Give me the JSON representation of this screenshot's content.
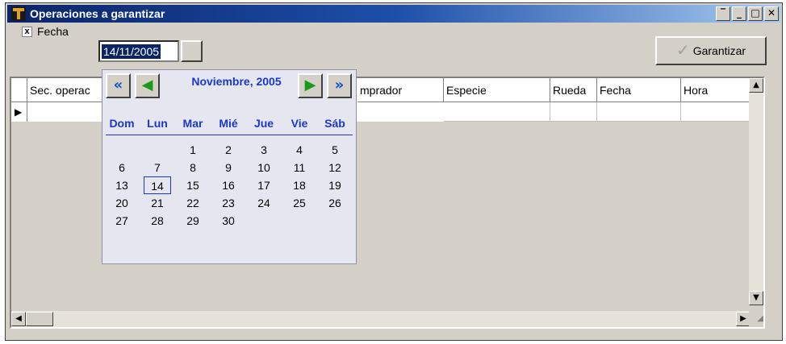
{
  "window": {
    "title": "Operaciones a garantizar"
  },
  "filter": {
    "checkbox_mark": "x",
    "fecha_label": "Fecha",
    "date_value": "14/11/2005"
  },
  "toolbar": {
    "garantizar_label": "Garantizar"
  },
  "grid": {
    "columns": [
      "Sec. operac",
      "mprador",
      "Especie",
      "Rueda",
      "Fecha",
      "Hora"
    ]
  },
  "calendar": {
    "month_label": "Noviembre, 2005",
    "weekdays": [
      "Dom",
      "Lun",
      "Mar",
      "Mié",
      "Jue",
      "Vie",
      "Sáb"
    ],
    "weeks": [
      [
        "",
        "",
        "1",
        "2",
        "3",
        "4",
        "5"
      ],
      [
        "6",
        "7",
        "8",
        "9",
        "10",
        "11",
        "12"
      ],
      [
        "13",
        "14",
        "15",
        "16",
        "17",
        "18",
        "19"
      ],
      [
        "20",
        "21",
        "22",
        "23",
        "24",
        "25",
        "26"
      ],
      [
        "27",
        "28",
        "29",
        "30",
        "",
        "",
        ""
      ]
    ],
    "selected_day": "14"
  },
  "colors": {
    "title_gradient_start": "#0a246a",
    "accent_blue": "#1a38c8",
    "nav_green": "#1a9a1a"
  }
}
